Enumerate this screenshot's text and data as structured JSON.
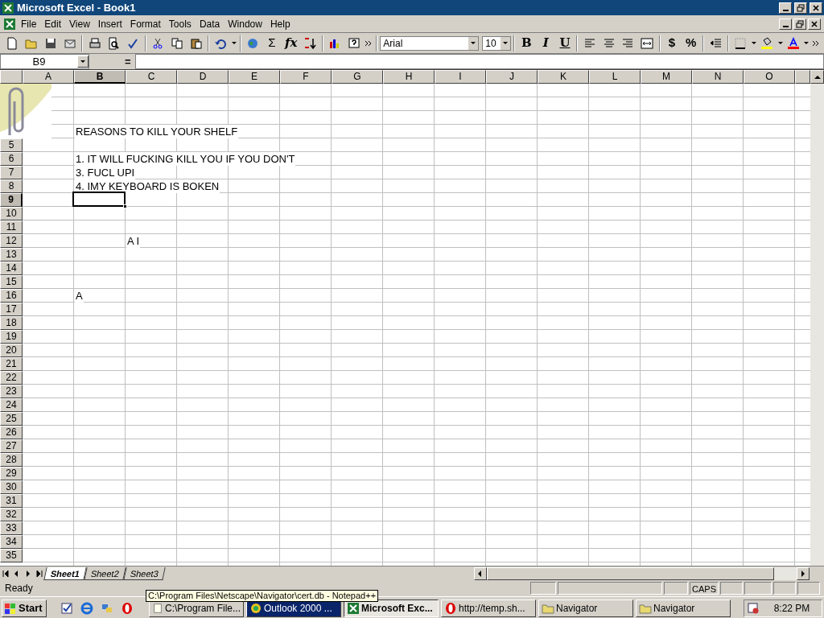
{
  "window": {
    "title": "Microsoft Excel - Book1"
  },
  "menu": [
    "File",
    "Edit",
    "View",
    "Insert",
    "Format",
    "Tools",
    "Data",
    "Window",
    "Help"
  ],
  "toolbar": {
    "sum_glyph": "Σ",
    "function_glyph": "fx",
    "font": "Arial",
    "size": "10",
    "bold": "B",
    "italic": "I",
    "underline": "U",
    "currency": "$",
    "percent": "%"
  },
  "formula_bar": {
    "name_box": "B9",
    "equals": "="
  },
  "columns": [
    {
      "label": "A",
      "selected": false
    },
    {
      "label": "B",
      "selected": true
    },
    {
      "label": "C",
      "selected": false
    },
    {
      "label": "D",
      "selected": false
    },
    {
      "label": "E",
      "selected": false
    },
    {
      "label": "F",
      "selected": false
    },
    {
      "label": "G",
      "selected": false
    },
    {
      "label": "H",
      "selected": false
    },
    {
      "label": "I",
      "selected": false
    },
    {
      "label": "J",
      "selected": false
    },
    {
      "label": "K",
      "selected": false
    },
    {
      "label": "L",
      "selected": false
    },
    {
      "label": "M",
      "selected": false
    },
    {
      "label": "N",
      "selected": false
    },
    {
      "label": "O",
      "selected": false
    }
  ],
  "rows": [
    {},
    {},
    {},
    {
      "cells": [
        null,
        "REASONS TO KILL YOUR SHELF"
      ]
    },
    {
      "label": "5",
      "selected": false
    },
    {
      "label": "6",
      "selected": false,
      "cells": [
        null,
        "1. IT WILL FUCKING KILL YOU IF YOU DON'T"
      ]
    },
    {
      "label": "7",
      "selected": false,
      "cells": [
        null,
        "3. FUCL UPI"
      ]
    },
    {
      "label": "8",
      "selected": false,
      "cells": [
        null,
        "4. IMY KEYBOARD IS BOKEN"
      ]
    },
    {
      "label": "9",
      "selected": true
    },
    {
      "label": "10",
      "selected": false
    },
    {
      "label": "11",
      "selected": false
    },
    {
      "label": "12",
      "selected": false,
      "cells": [
        null,
        null,
        "A I"
      ]
    },
    {
      "label": "13",
      "selected": false
    },
    {
      "label": "14",
      "selected": false
    },
    {
      "label": "15",
      "selected": false
    },
    {
      "label": "16",
      "selected": false,
      "cells": [
        null,
        "A"
      ]
    },
    {
      "label": "17",
      "selected": false
    },
    {
      "label": "18",
      "selected": false
    },
    {
      "label": "19",
      "selected": false
    },
    {
      "label": "20",
      "selected": false
    },
    {
      "label": "21",
      "selected": false
    },
    {
      "label": "22",
      "selected": false
    },
    {
      "label": "23",
      "selected": false
    },
    {
      "label": "24",
      "selected": false
    },
    {
      "label": "25",
      "selected": false
    },
    {
      "label": "26",
      "selected": false
    },
    {
      "label": "27",
      "selected": false
    },
    {
      "label": "28",
      "selected": false
    },
    {
      "label": "29",
      "selected": false
    },
    {
      "label": "30",
      "selected": false
    },
    {
      "label": "31",
      "selected": false
    },
    {
      "label": "32",
      "selected": false
    },
    {
      "label": "33",
      "selected": false
    },
    {
      "label": "34",
      "selected": false
    },
    {
      "label": "35",
      "selected": false
    }
  ],
  "sheet_tabs": [
    {
      "label": "Sheet1",
      "selected": true
    },
    {
      "label": "Sheet2",
      "selected": false
    },
    {
      "label": "Sheet3",
      "selected": false
    }
  ],
  "status_bar": {
    "text": "Ready",
    "indicator": "CAPS"
  },
  "taskbar": {
    "start": "Start",
    "tasks": [
      {
        "label": "C:\\Program File...",
        "kind": "notepad",
        "selected": false,
        "flashing": false
      },
      {
        "label": "Outlook 2000 ...",
        "kind": "outlook",
        "selected": false,
        "flashing": true
      },
      {
        "label": "Microsoft Exc...",
        "kind": "excel",
        "selected": true,
        "flashing": false
      },
      {
        "label": "http://temp.sh...",
        "kind": "opera",
        "selected": false,
        "flashing": false
      },
      {
        "label": "Navigator",
        "kind": "folder",
        "selected": false,
        "flashing": false
      },
      {
        "label": "Navigator",
        "kind": "folder",
        "selected": false,
        "flashing": false
      }
    ],
    "clock": "8:22 PM"
  },
  "tooltip": "C:\\Program Files\\Netscape\\Navigator\\cert.db - Notepad++"
}
